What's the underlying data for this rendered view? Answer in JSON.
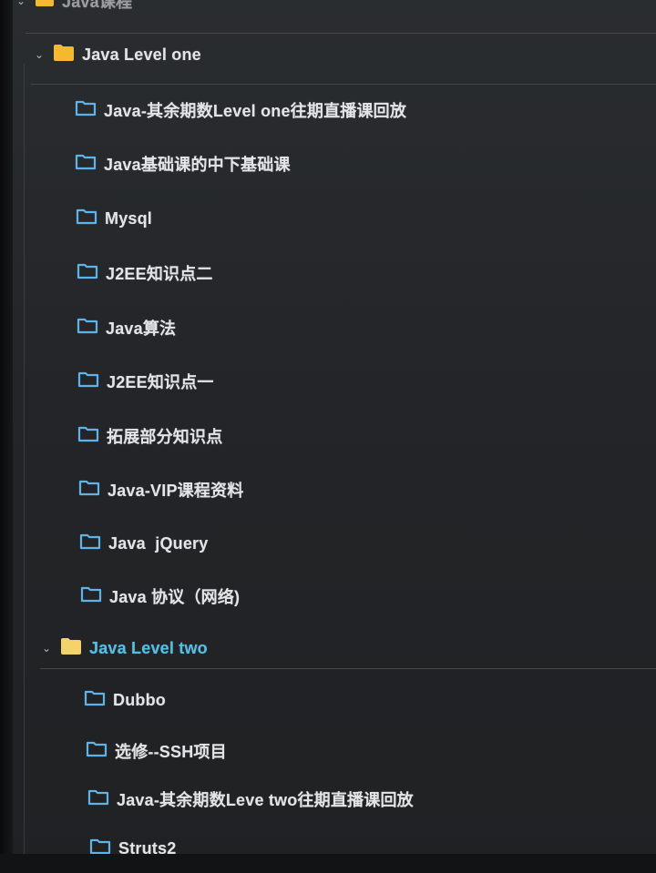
{
  "root": {
    "label": "Java课程",
    "expanded": true,
    "folder_color": "#f4b92c"
  },
  "groups": [
    {
      "label": "Java Level one",
      "expanded": true,
      "folder_color": "#f4b92c",
      "label_color": "#e3e4e6",
      "children": [
        {
          "label": "Java-其余期数Level one往期直播课回放"
        },
        {
          "label": "Java基础课的中下基础课"
        },
        {
          "label": "Mysql"
        },
        {
          "label": "J2EE知识点二"
        },
        {
          "label": "Java算法"
        },
        {
          "label": "J2EE知识点一"
        },
        {
          "label": "拓展部分知识点"
        },
        {
          "label": "Java-VIP课程资料"
        },
        {
          "label": "Java  jQuery"
        },
        {
          "label": "Java 协议（网络)"
        }
      ]
    },
    {
      "label": "Java Level two",
      "expanded": true,
      "folder_color": "#f4d46a",
      "label_color": "#4fc1e9",
      "children": [
        {
          "label": "Dubbo"
        },
        {
          "label": "选修--SSH项目"
        },
        {
          "label": "Java-其余期数Leve two往期直播课回放"
        },
        {
          "label": "Struts2"
        }
      ]
    }
  ],
  "icons": {
    "expand": "chevron-down-icon",
    "group_folder": "folder-filled-icon",
    "child_folder": "folder-outline-icon"
  },
  "colors": {
    "background": "#232528",
    "outline_folder": "#5fb3e8",
    "text": "#e3e4e6",
    "accent": "#4fc1e9"
  }
}
